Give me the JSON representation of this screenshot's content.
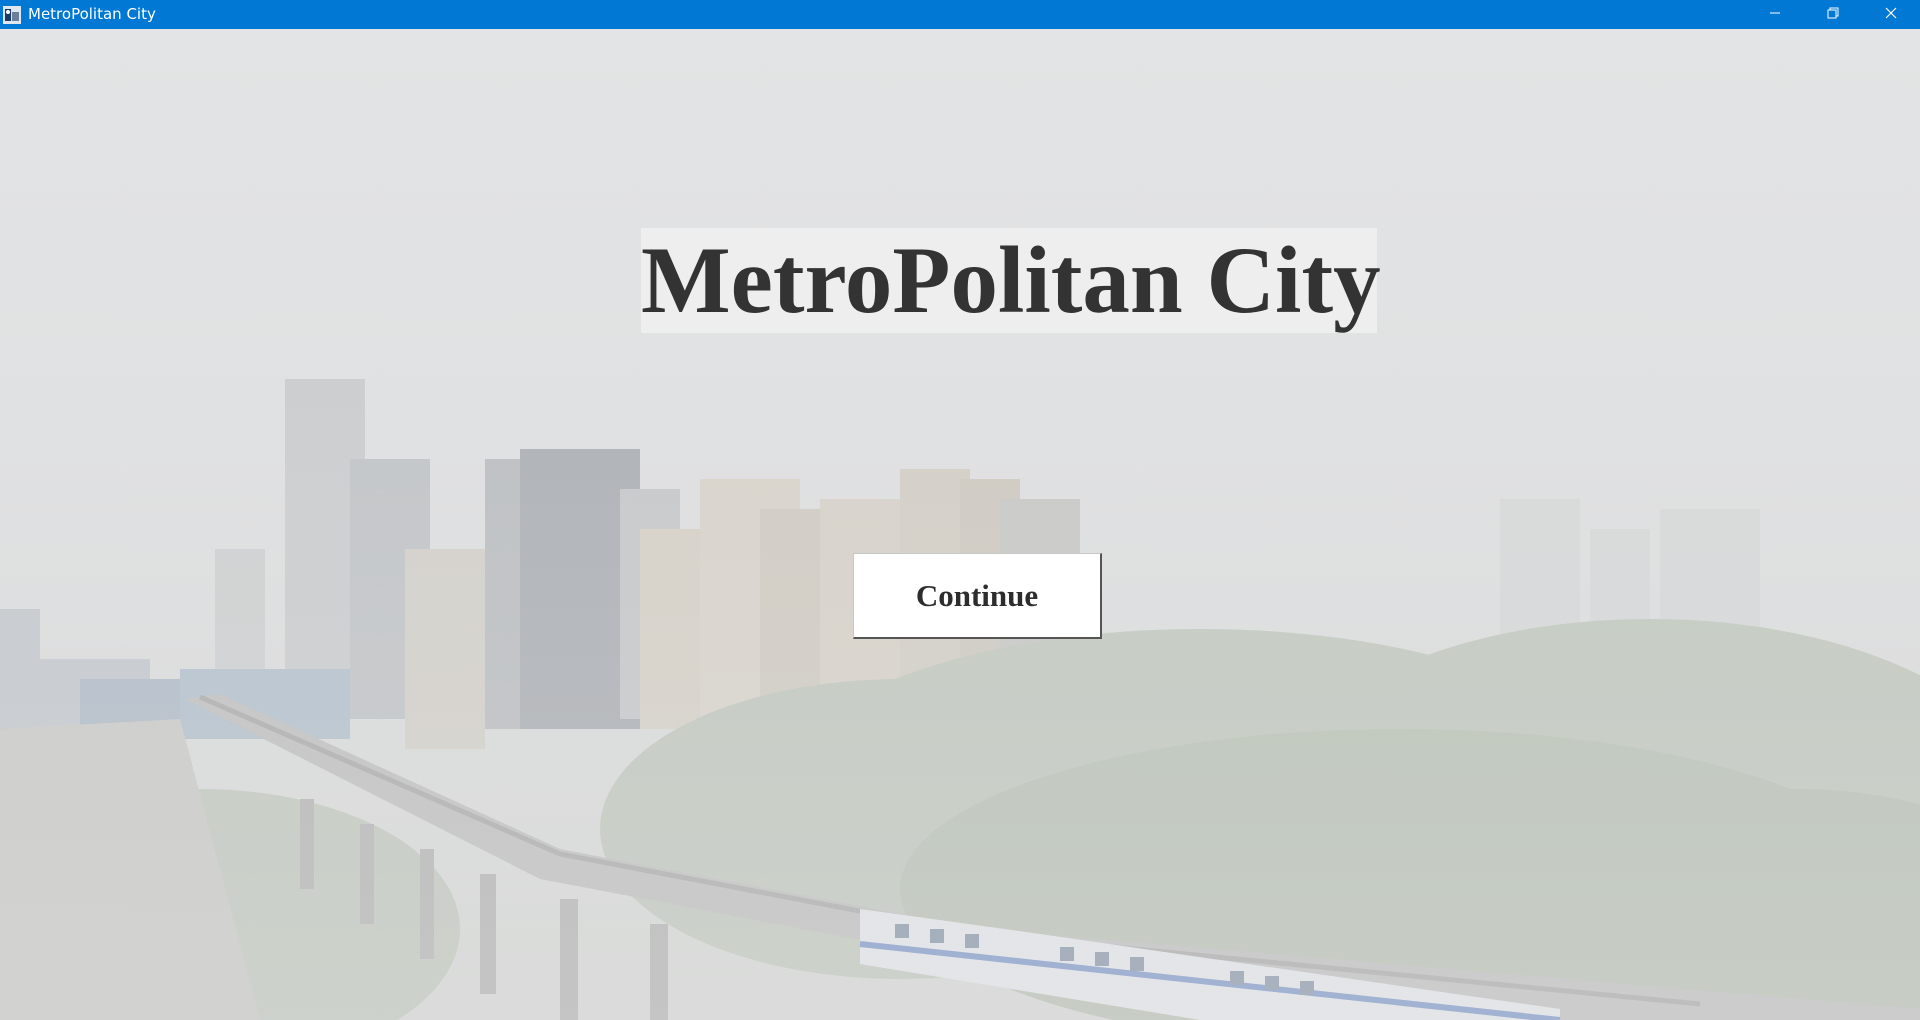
{
  "window": {
    "title": "MetroPolitan City",
    "controls": [
      "minimize-icon",
      "restore-icon",
      "close-icon"
    ],
    "accent": "#0078d4"
  },
  "main": {
    "title": "MetroPolitan City",
    "continue_label": "Continue"
  },
  "background": {
    "description_icon": "city-skyline-metro-photo"
  }
}
